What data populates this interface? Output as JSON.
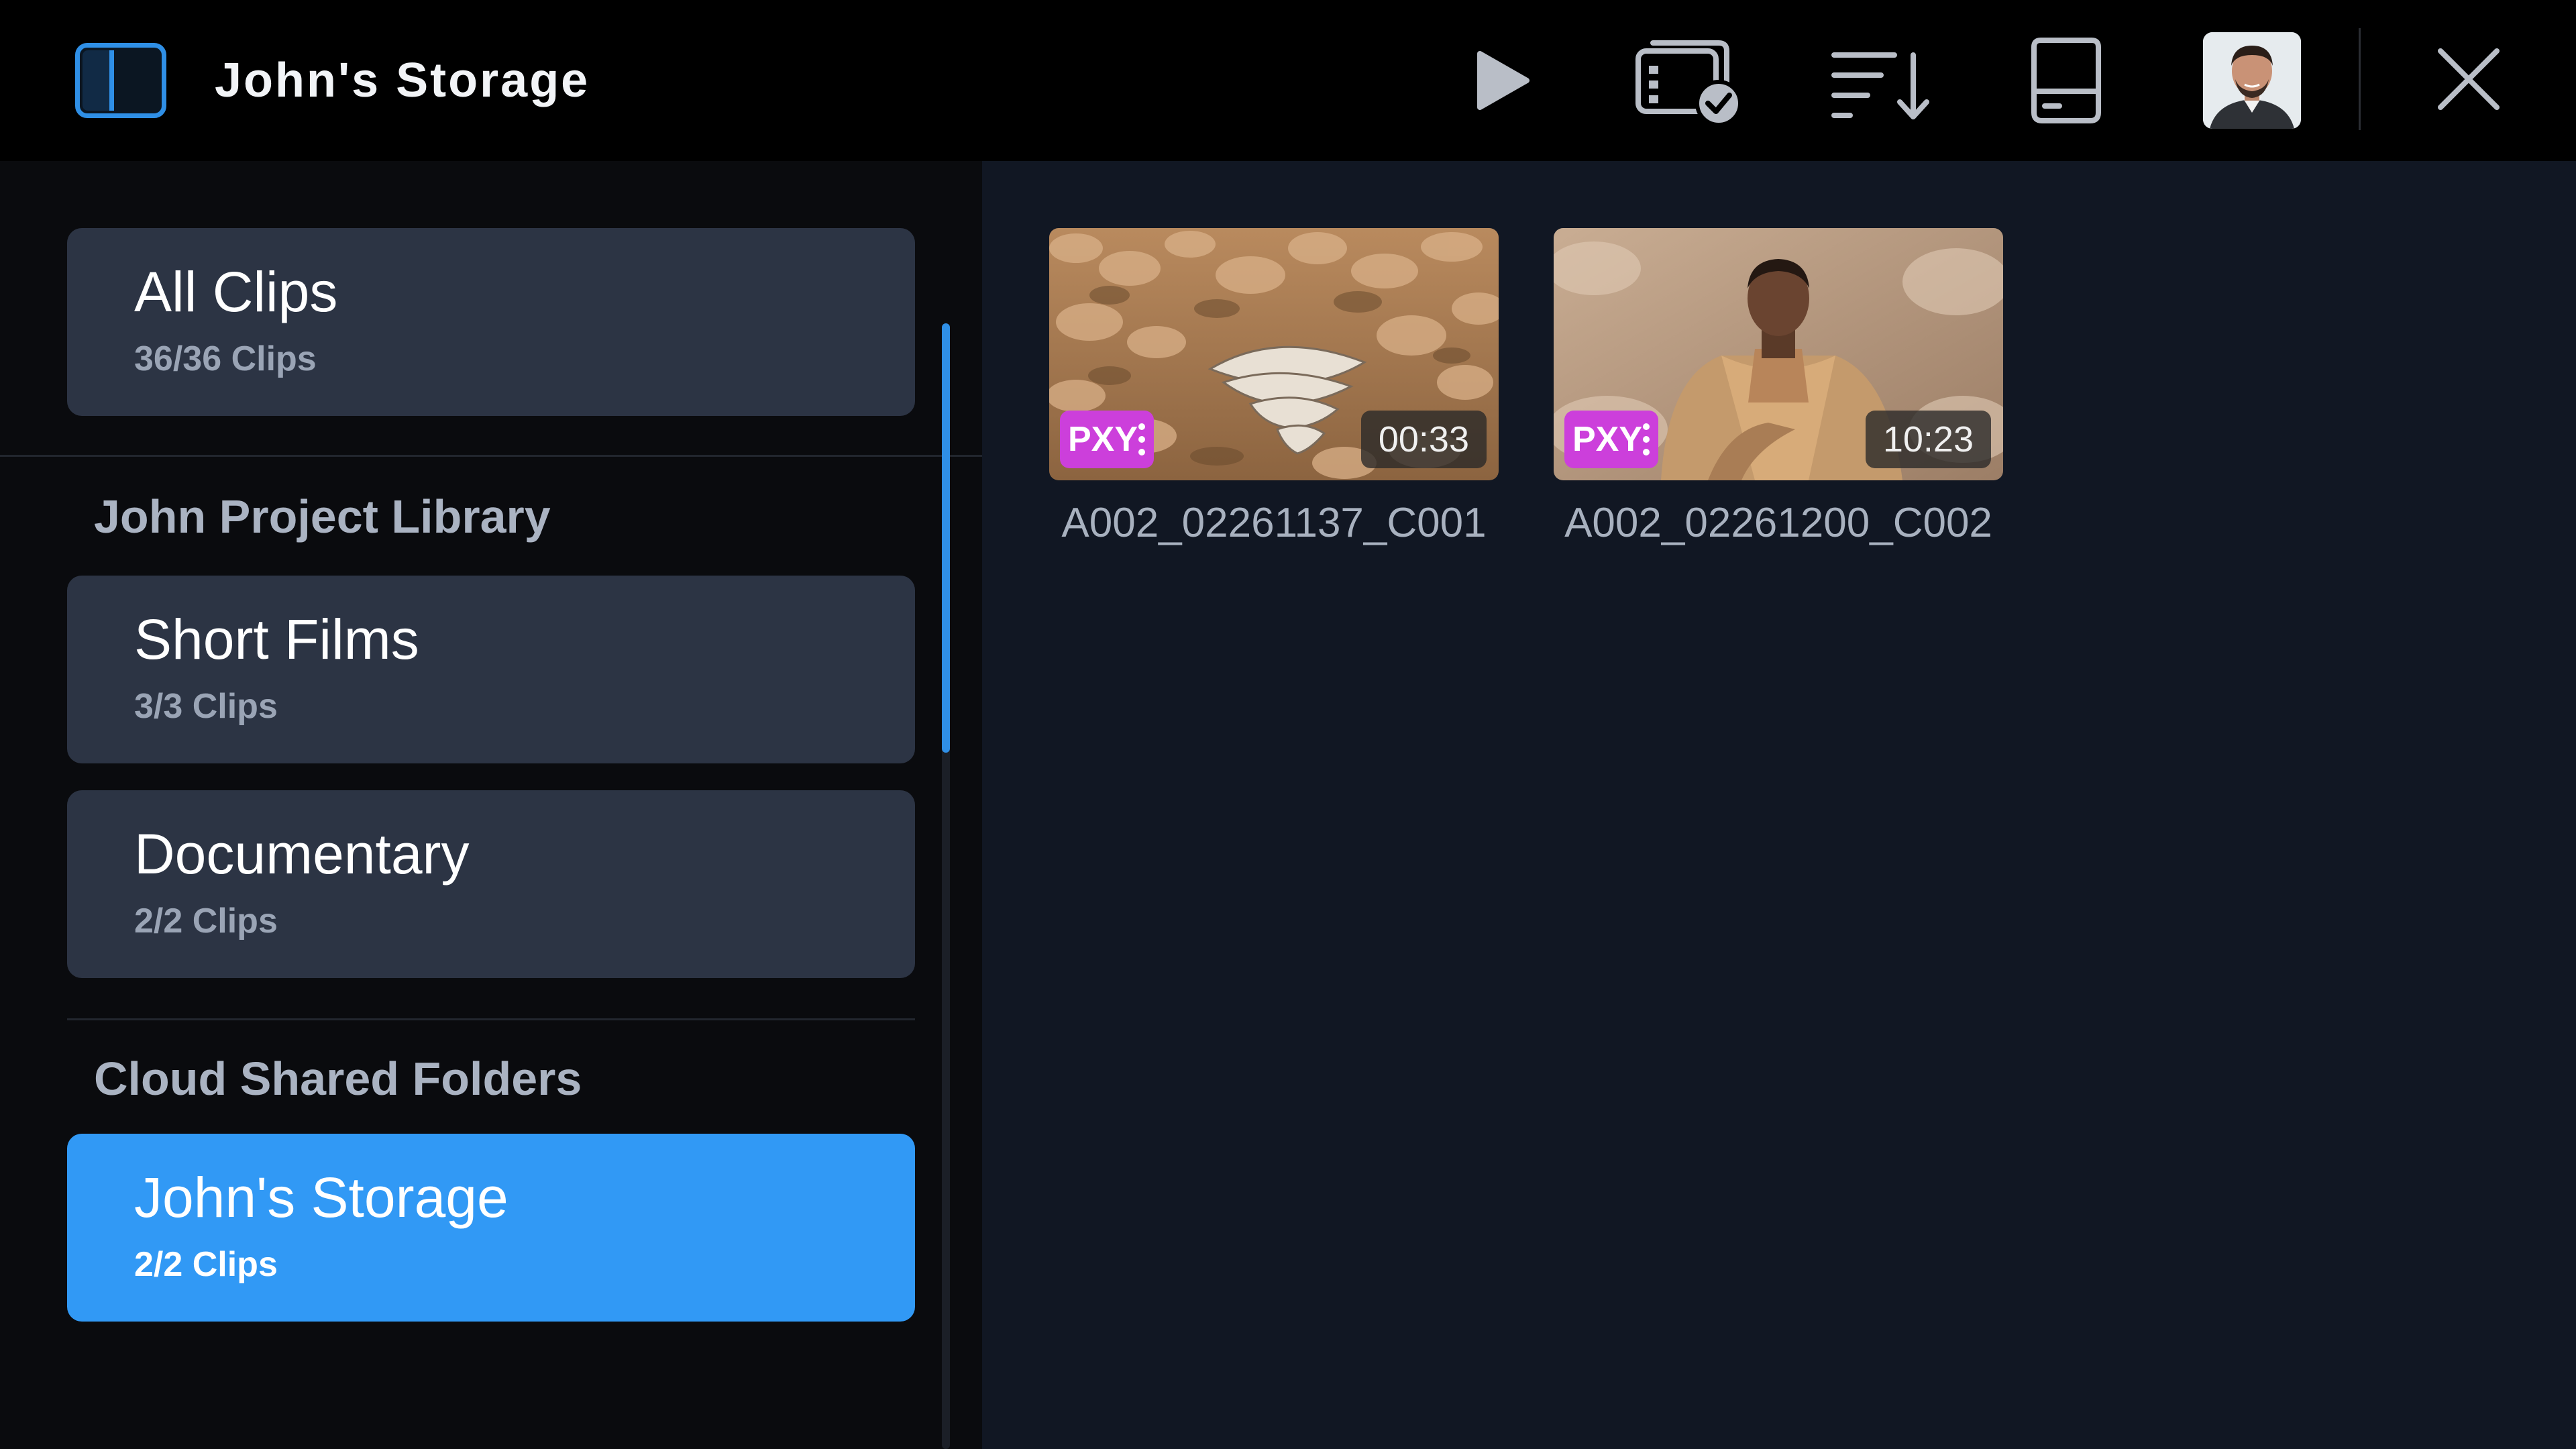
{
  "header": {
    "title": "John's Storage"
  },
  "sidebar": {
    "all_clips": {
      "title": "All Clips",
      "count": "36/36 Clips"
    },
    "sections": [
      {
        "label": "John Project Library",
        "items": [
          {
            "title": "Short Films",
            "count": "3/3 Clips"
          },
          {
            "title": "Documentary",
            "count": "2/2 Clips"
          }
        ]
      },
      {
        "label": "Cloud Shared Folders",
        "items": [
          {
            "title": "John's Storage",
            "count": "2/2 Clips",
            "selected": true
          }
        ]
      }
    ]
  },
  "clips": [
    {
      "name": "A002_02261137_C001",
      "duration": "00:33",
      "badge": "PXY"
    },
    {
      "name": "A002_02261200_C002",
      "duration": "10:23",
      "badge": "PXY"
    }
  ],
  "colors": {
    "accent": "#3199f5",
    "badge": "#cc3fdb",
    "card": "#2c3444",
    "topbar": "#000000"
  },
  "icons": [
    "sidebar-toggle-icon",
    "play-icon",
    "clips-check-icon",
    "sort-icon",
    "drive-icon",
    "close-icon"
  ]
}
